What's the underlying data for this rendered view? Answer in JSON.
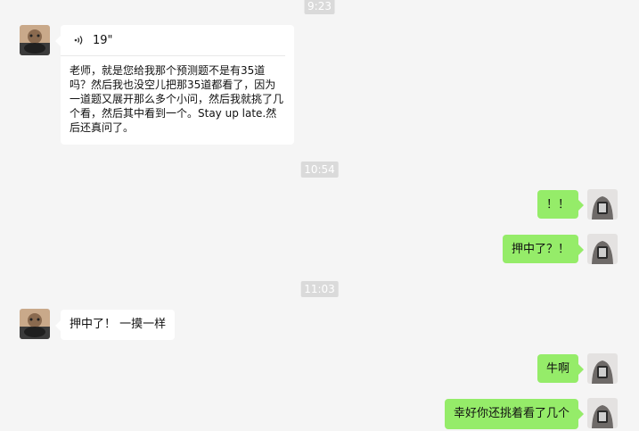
{
  "timestamps": {
    "t1": "9:23",
    "t2": "10:54",
    "t3": "11:03"
  },
  "messages": {
    "voice": {
      "duration": "19\"",
      "transcript": "老师，就是您给我那个预测题不是有35道吗？然后我也没空儿把那35道都看了，因为一道题又展开那么多个小问，然后我就挑了几个看，然后其中看到一个。Stay up late.然后还真问了。"
    },
    "m2": "！！",
    "m3": "押中了？！",
    "m4": "押中了！ 一摸一样",
    "m5": "牛啊",
    "m6": "幸好你还挑着看了几个"
  },
  "colors": {
    "background": "#f5f5f5",
    "self_bubble": "#95ec69",
    "other_bubble": "#ffffff",
    "timestamp_bg": "#dadada"
  },
  "icons": {
    "voice": "voice-wave-icon"
  }
}
